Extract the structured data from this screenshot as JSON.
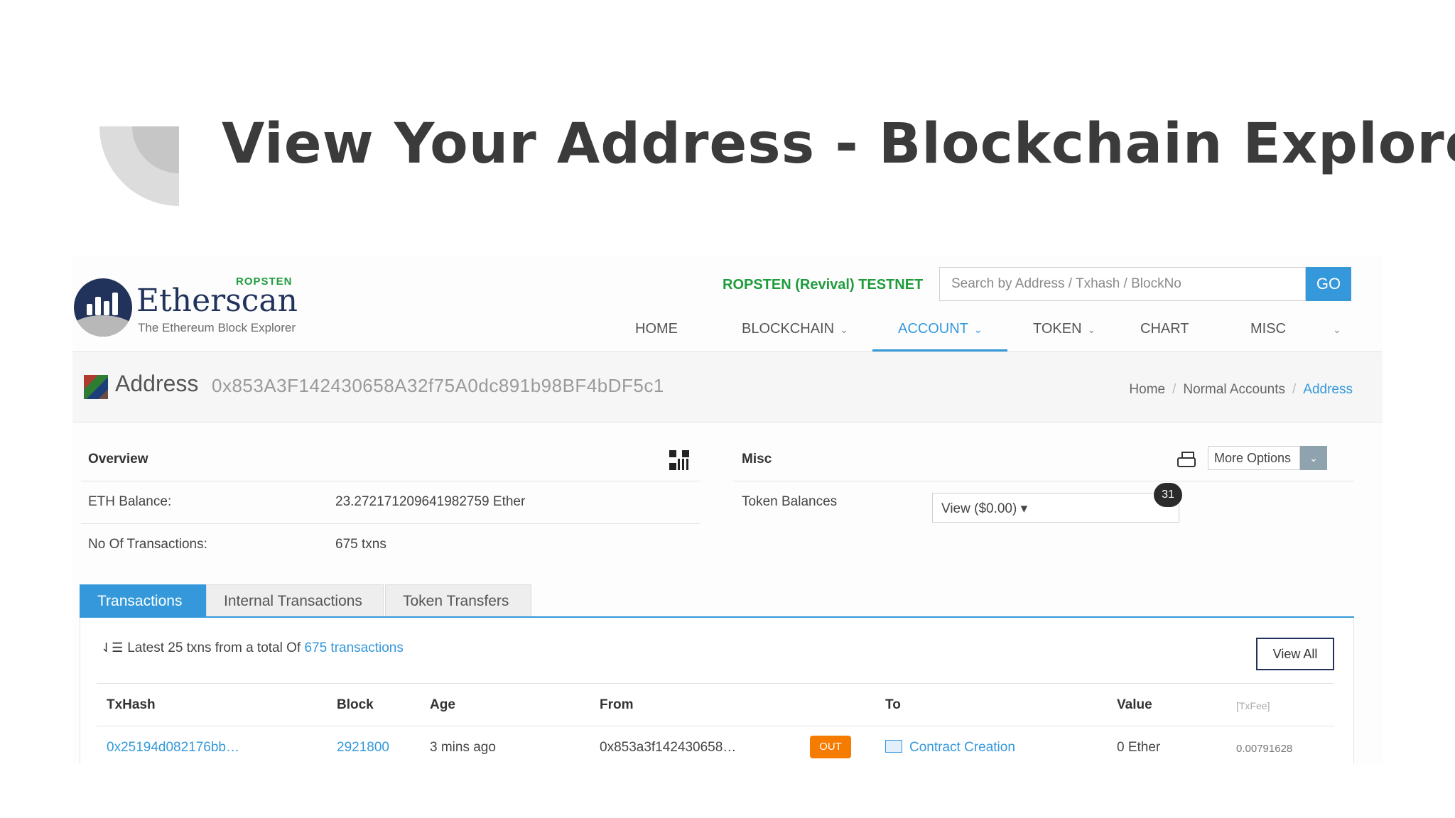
{
  "slide": {
    "title": "View Your Address - Blockchain Explorer"
  },
  "header": {
    "logo_network": "ROPSTEN",
    "logo_name": "Etherscan",
    "logo_tagline": "The Ethereum Block Explorer",
    "testnet_label": "ROPSTEN (Revival) TESTNET",
    "search_placeholder": "Search by Address / Txhash / BlockNo",
    "go_label": "GO",
    "nav": [
      {
        "label": "HOME"
      },
      {
        "label": "BLOCKCHAIN"
      },
      {
        "label": "ACCOUNT"
      },
      {
        "label": "TOKEN"
      },
      {
        "label": "CHART"
      },
      {
        "label": "MISC"
      }
    ],
    "active_nav": "ACCOUNT",
    "accent_color": "#3498db"
  },
  "address_bar": {
    "label": "Address",
    "hash": "0x853A3F142430658A32f75A0dc891b98BF4bDF5c1",
    "breadcrumb": [
      "Home",
      "Normal Accounts",
      "Address"
    ]
  },
  "overview": {
    "title": "Overview",
    "rows": [
      {
        "label": "ETH Balance:",
        "value": "23.272171209641982759 Ether"
      },
      {
        "label": "No Of Transactions:",
        "value": "675 txns"
      }
    ]
  },
  "misc": {
    "title": "Misc",
    "more_options": "More Options",
    "token_balances_label": "Token Balances",
    "token_select_value": "View ($0.00) ▾",
    "token_count_badge": "31"
  },
  "tabs": [
    {
      "label": "Transactions",
      "active": true
    },
    {
      "label": "Internal Transactions",
      "active": false
    },
    {
      "label": "Token Transfers",
      "active": false
    }
  ],
  "transactions": {
    "summary_prefix": "Latest 25 txns from a total Of",
    "summary_link": "675 transactions",
    "view_all": "View All",
    "columns": [
      "TxHash",
      "Block",
      "Age",
      "From",
      "To",
      "Value",
      "[TxFee]"
    ],
    "rows": [
      {
        "txhash": "0x25194d082176bb…",
        "block": "2921800",
        "age": "3 mins ago",
        "from": "0x853a3f142430658…",
        "direction": "OUT",
        "to": "Contract Creation",
        "value": "0 Ether",
        "fee": "0.00791628"
      }
    ]
  }
}
